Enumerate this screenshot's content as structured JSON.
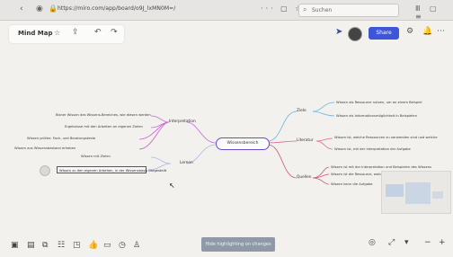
{
  "browser": {
    "url": "https://miro.com/app/board/o9J_lxMN0M=/",
    "search_placeholder": "Suchen"
  },
  "toolbar": {
    "title": "Mind Map",
    "share_label": "Share"
  },
  "mindmap": {
    "central": "Wissensbereich",
    "branches": {
      "interpretation": "Interpretation",
      "ziele": "Ziele",
      "lernen": "Lernen",
      "literatur": "Literatur",
      "quellen": "Quellen"
    },
    "left_nodes": [
      "Bisher Wissen des Wissens-Bereiches, wie diesen werden",
      "Ergebnisse mit den Arbeiten an eigenen Zielen",
      "Wissen prüfen: Fach- und Beratungstexte",
      "Wissen aus Wissensbestand erheben",
      "Vollständiges Wissen und Interpretation zu Wissensbedarf"
    ],
    "bottom_left_nodes": [
      "Wissen mit Zielen",
      "Wissen zu den eigenen Arbeiten, in der Wissensbasis dargestellt"
    ],
    "right_top_nodes": [
      "Wissen als Ressource nutzen, um an einem Beispiel",
      "Wissen als Informationsmöglichkeit in Beispielen"
    ],
    "right_mid_nodes": [
      "Wissen ist, welche Ressourcen zu verwenden sind und welche",
      "Wissen ist, mit der Interpretation der Aufgabe"
    ],
    "right_bottom_nodes": [
      "Wissen ist mit der Interpretation und Beispielen des Wissens",
      "Wissen ist die Ressource, welche die aufgabenbezogene Wissens",
      "Wissen kann die Aufgabe"
    ]
  },
  "bottom": {
    "hide_highlighting": "Hide highlighting on changes"
  },
  "icons": {
    "browser_back": "chevron-left-icon",
    "share": "share-icon",
    "settings": "settings-icon",
    "notifications": "bell-icon"
  }
}
